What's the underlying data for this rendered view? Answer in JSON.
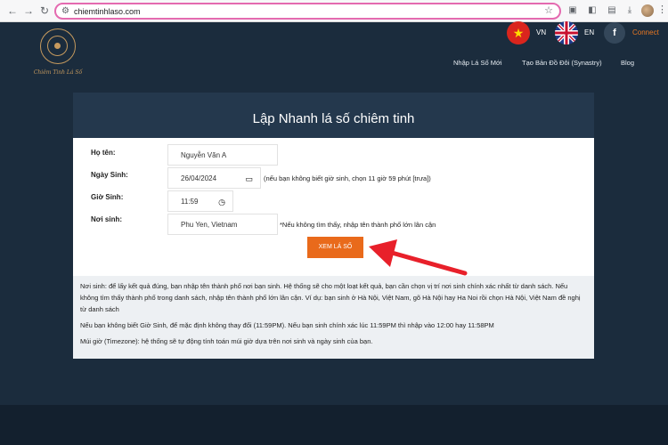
{
  "browser": {
    "url": "chiemtinhlaso.com"
  },
  "header": {
    "logo_text": "Chiêm Tinh Lá Số",
    "lang_vn": "VN",
    "lang_en": "EN",
    "connect": "Connect",
    "nav": [
      "Nhập Lá Số Mới",
      "Tạo Bản Đồ Đôi (Synastry)",
      "Blog"
    ]
  },
  "form": {
    "title": "Lập Nhanh lá số chiêm tinh",
    "name_label": "Họ tên:",
    "name_value": "Nguyễn Văn A",
    "dob_label": "Ngày Sinh:",
    "dob_value": "26/04/2024",
    "dob_hint": "(nếu bạn không biết giờ sinh, chọn 11 giờ 59 phút [trưa])",
    "time_label": "Giờ Sinh:",
    "time_value": "11:59",
    "place_label": "Nơi sinh:",
    "place_value": "Phu Yen, Vietnam",
    "place_hint": "*Nếu không tìm thấy, nhập tên thành phố lớn lân cận",
    "submit": "XEM LÁ SỐ"
  },
  "info": [
    "Nơi sinh: để lấy kết quả đúng, bạn nhập tên thành phố nơi bạn sinh. Hệ thống sẽ cho một loạt kết quả, bạn cần chọn vị trí nơi sinh chính xác nhất từ danh sách. Nếu không tìm thấy thành phố trong danh sách, nhập tên thành phố lớn lân cận. Ví dụ: bạn sinh ở Hà Nội, Việt Nam, gõ Hà Nội hay Ha Noi rồi chọn Hà Nội, Việt Nam đề nghị từ danh sách",
    "Nếu bạn không biết Giờ Sinh, để mặc định không thay đổi (11:59PM). Nếu bạn sinh chính xác lúc 11:59PM thì nhập vào 12:00 hay 11:58PM",
    "Múi giờ (Timezone): hệ thống sẽ tự động tính toán múi giờ dựa trên nơi sinh và ngày sinh của bạn."
  ],
  "colors": {
    "page_bg": "#1b2c3d",
    "card_header": "#24384d",
    "accent_orange": "#e96a1b",
    "arrow_red": "#e8202a",
    "url_highlight": "#e46ab0"
  },
  "icons": [
    "back-icon",
    "forward-icon",
    "reload-icon",
    "site-info-icon",
    "star-icon",
    "vn-flag-icon",
    "uk-flag-icon",
    "facebook-icon",
    "calendar-icon",
    "clock-icon",
    "arrow-annotation"
  ]
}
